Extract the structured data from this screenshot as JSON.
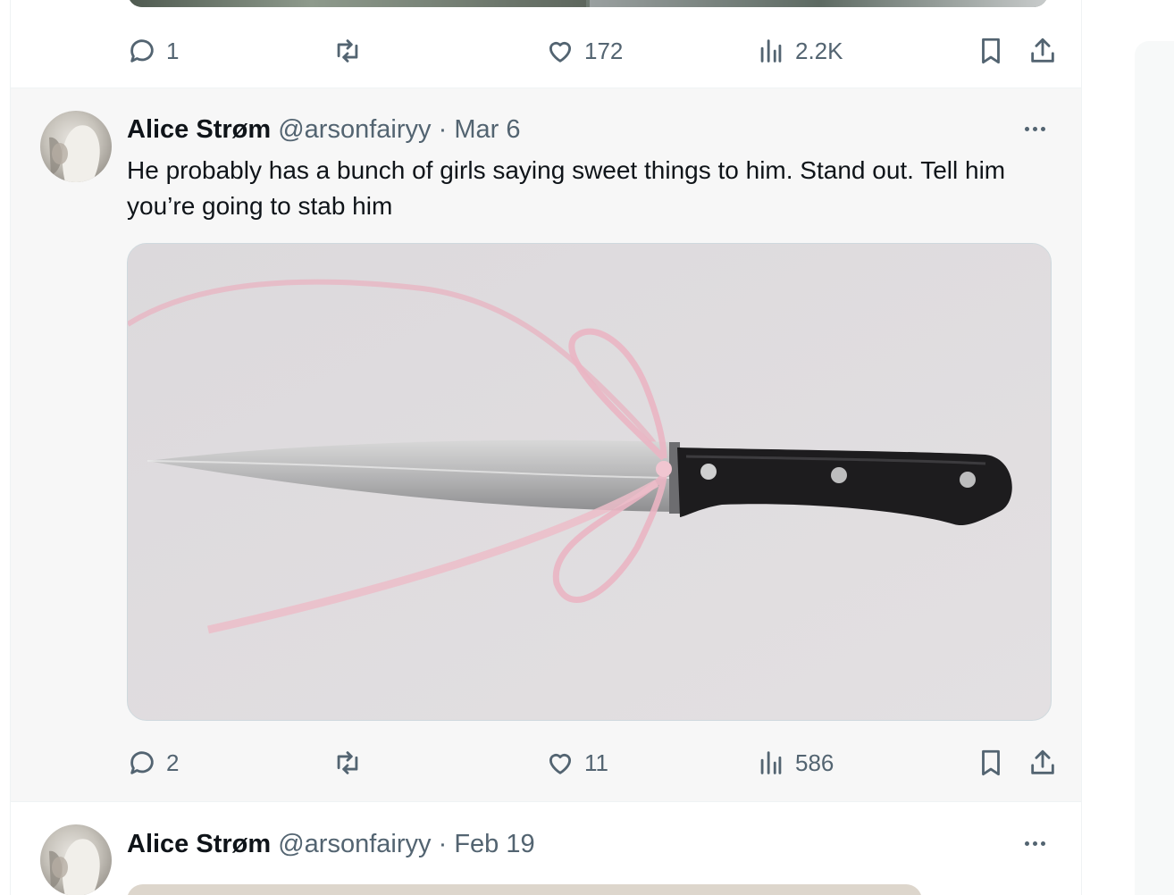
{
  "posts": [
    {
      "actions": {
        "replies": "1",
        "likes": "172",
        "views": "2.2K"
      }
    },
    {
      "author_name": "Alice Strøm",
      "handle": "@arsonfairyy",
      "separator": "·",
      "date": "Mar 6",
      "text": "He probably has a bunch of girls saying sweet things to him. Stand out. Tell him you’re going to stab him",
      "media": "knife tied with pink ribbon bow",
      "actions": {
        "replies": "2",
        "likes": "11",
        "views": "586"
      }
    },
    {
      "author_name": "Alice Strøm",
      "handle": "@arsonfairyy",
      "separator": "·",
      "date": "Feb 19"
    }
  ],
  "icons": {
    "reply": "reply-icon",
    "retweet": "retweet-icon",
    "like": "heart-icon",
    "views": "views-icon",
    "bookmark": "bookmark-icon",
    "share": "share-icon",
    "more": "more-icon"
  },
  "colors": {
    "muted": "#536471",
    "text": "#0f1419",
    "highlight_bg": "#f7f7f7",
    "border": "#eff3f4"
  }
}
